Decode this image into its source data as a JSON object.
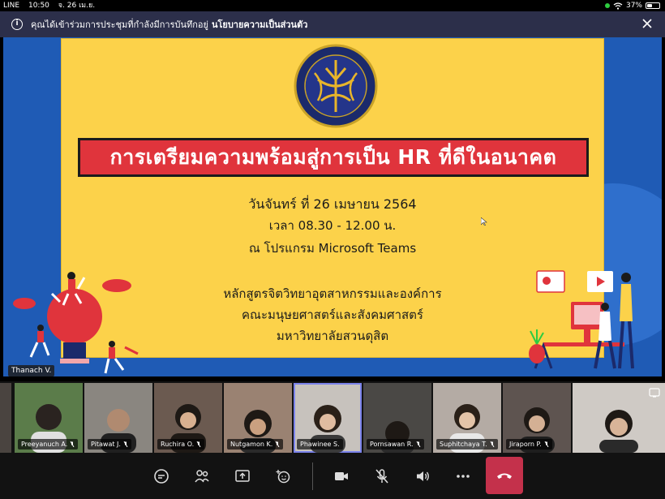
{
  "status_bar": {
    "app": "LINE",
    "time": "10:50",
    "date": "จ. 26 เม.ย.",
    "battery": "37%"
  },
  "notice": {
    "text": "คุณได้เข้าร่วมการประชุมที่กำลังมีการบันทึกอยู่",
    "link": "นโยบายความเป็นส่วนตัว"
  },
  "slide": {
    "title": "การเตรียมความพร้อมสู่การเป็น HR ที่ดีในอนาคต",
    "date_line": "วันจันทร์ ที่ 26 เมษายน 2564",
    "time_line": "เวลา 08.30 - 12.00 น.",
    "venue_line": "ณ โปรแกรม Microsoft Teams",
    "org_line1": "หลักสูตรจิตวิทยาอุตสาหกรรมและองค์การ",
    "org_line2": "คณะมนุษยศาสตร์และสังคมศาสตร์",
    "org_line3": "มหาวิทยาลัยสวนดุสิต"
  },
  "presenter": "Thanach V.",
  "participants": [
    {
      "name": "Preeyanuch A.",
      "bg": "#5b7c4a",
      "muted": true
    },
    {
      "name": "Pitawat J.",
      "bg": "#8a8680",
      "muted": true
    },
    {
      "name": "Ruchira O.",
      "bg": "#6b5a50",
      "muted": true
    },
    {
      "name": "Nutgamon K.",
      "bg": "#9a8272",
      "muted": true
    },
    {
      "name": "Phawinee S.",
      "bg": "#c7c2bd",
      "muted": false
    },
    {
      "name": "Pornsawan R.",
      "bg": "#4a4845",
      "muted": true
    },
    {
      "name": "Suphitchaya T.",
      "bg": "#b4aba4",
      "muted": true
    },
    {
      "name": "Jiraporn P.",
      "bg": "#5e5450",
      "muted": true
    },
    {
      "name": "",
      "bg": "#cfcac5",
      "muted": false
    }
  ],
  "toolbar": {
    "chat": "chat-icon",
    "participants": "people-icon",
    "share": "share-screen-icon",
    "reactions": "reactions-icon",
    "camera": "camera-icon",
    "mic": "mic-off-icon",
    "speaker": "speaker-icon",
    "more": "more-icon",
    "hangup": "hang-up-icon"
  },
  "colors": {
    "share_bg": "#1f5bb5",
    "slide_bg": "#fcd24a",
    "title_bg": "#e0343c",
    "hangup": "#c4314b",
    "selected_tile": "#7b83eb"
  }
}
